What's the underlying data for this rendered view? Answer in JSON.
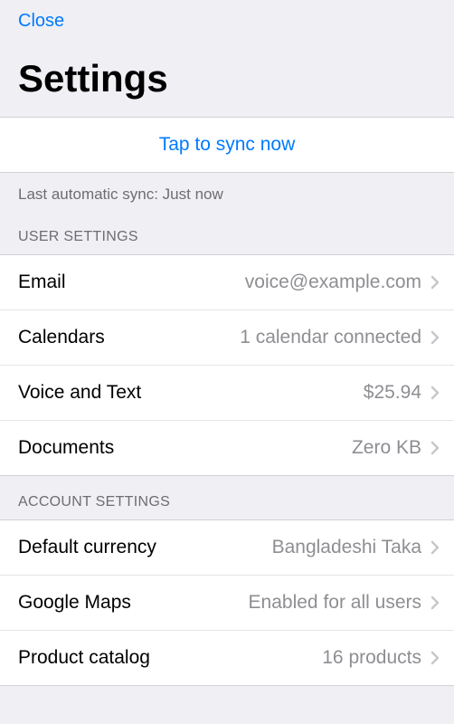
{
  "header": {
    "close_label": "Close",
    "title": "Settings"
  },
  "sync": {
    "button_label": "Tap to sync now",
    "last_sync_text": "Last automatic sync: Just now"
  },
  "sections": {
    "user": {
      "header": "USER SETTINGS",
      "items": [
        {
          "label": "Email",
          "value": "voice@example.com"
        },
        {
          "label": "Calendars",
          "value": "1 calendar connected"
        },
        {
          "label": "Voice and Text",
          "value": "$25.94"
        },
        {
          "label": "Documents",
          "value": "Zero KB"
        }
      ]
    },
    "account": {
      "header": "ACCOUNT SETTINGS",
      "items": [
        {
          "label": "Default currency",
          "value": "Bangladeshi Taka"
        },
        {
          "label": "Google Maps",
          "value": "Enabled for all users"
        },
        {
          "label": "Product catalog",
          "value": "16 products"
        }
      ]
    }
  }
}
